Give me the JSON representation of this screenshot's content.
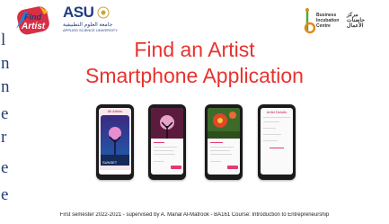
{
  "edge_letters": [
    "l",
    "n",
    "n",
    "e",
    "r",
    "e",
    "e"
  ],
  "logos": {
    "find_artist": {
      "line1": "Find",
      "line2": "Artist"
    },
    "asu": {
      "name": "ASU",
      "arabic": "جامعة العلوم التطبيقية",
      "english": "APPLIED SCIENCE UNIVERSITY"
    },
    "bic": {
      "english": "Business Incubation Centre",
      "arabic": "مركز حاضنات الأعمال"
    }
  },
  "title": {
    "line1": "Find an Artist",
    "line2": "Smartphone Application"
  },
  "phones": [
    {
      "screen": "home",
      "header": "All Artists",
      "caption": "SUNSET"
    },
    {
      "screen": "details",
      "header": ""
    },
    {
      "screen": "flower",
      "header": ""
    },
    {
      "screen": "profile",
      "header": "Artist Details"
    }
  ],
  "footer": "First semester 2022-2021 - supervised by A. Manal Al-Matrook - BA161 Course: Introduction to Entrepreneurship",
  "colors": {
    "title_red": "#e8332f",
    "asu_blue": "#1f3c82",
    "app_pink": "#e43a6d"
  }
}
